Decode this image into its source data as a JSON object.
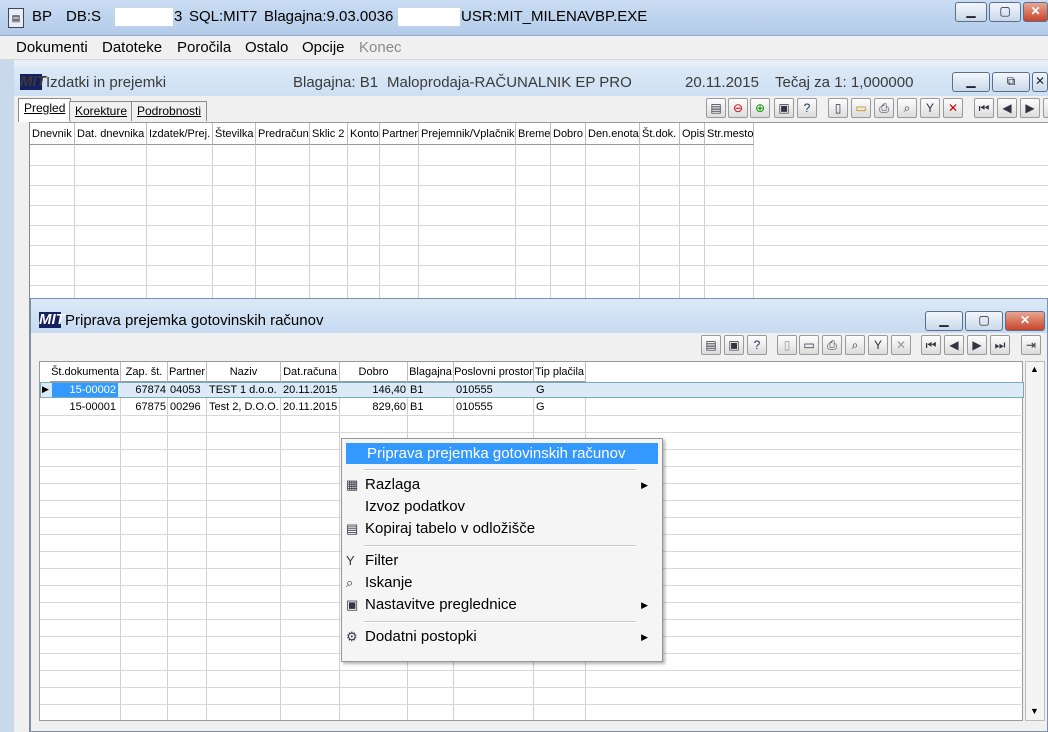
{
  "titlebar": {
    "app": "BP",
    "db": "DB:S",
    "db_tail": "3",
    "sql": "SQL:MIT7",
    "blagajna": "Blagajna:9.03.0036",
    "usr": "USR:MIT_MILENA",
    "exe": "VBP.EXE"
  },
  "menu": {
    "items": [
      "Dokumenti",
      "Datoteke",
      "Poročila",
      "Ostalo",
      "Opcije",
      "Konec"
    ]
  },
  "child": {
    "title": "Izdatki in prejemki",
    "blagajna": "Blagajna: B1",
    "maloprodaja": "Maloprodaja-RAČUNALNIK EP PRO",
    "date": "20.11.2015",
    "tecaj": "Tečaj za 1: 1,000000",
    "logo": "MIT",
    "tabs": [
      "Pregled",
      "Korekture",
      "Podrobnosti"
    ],
    "columns": [
      "Dnevnik",
      "Dat. dnevnika",
      "Izdatek/Prej.",
      "Številka",
      "Predračun",
      "Sklic 2",
      "Konto",
      "Partner",
      "Prejemnik/Vplačnik",
      "Breme",
      "Dobro",
      "Den.enota",
      "Št.dok.",
      "Opis",
      "Str.mesto"
    ]
  },
  "dialog": {
    "title": "Priprava prejemka gotovinskih računov",
    "columns": [
      "Št.dokumenta",
      "Zap. št.",
      "Partner",
      "Naziv",
      "Dat.računa",
      "Dobro",
      "Blagajna",
      "Poslovni prostor",
      "Tip plačila"
    ],
    "rows": [
      [
        "15-00002",
        "67874",
        "04053",
        "TEST 1 d.o.o.",
        "20.11.2015",
        "146,40",
        "B1",
        "010555",
        "G"
      ],
      [
        "15-00001",
        "67875",
        "00296",
        "Test 2, D.O.O.",
        "20.11.2015",
        "829,60",
        "B1",
        "010555",
        "G"
      ]
    ]
  },
  "context_menu": {
    "items": [
      "Priprava prejemka gotovinskih računov",
      "Razlaga",
      "Izvoz podatkov",
      "Kopiraj tabelo v odložišče",
      "Filter",
      "Iskanje",
      "Nastavitve preglednice",
      "Dodatni postopki"
    ]
  }
}
